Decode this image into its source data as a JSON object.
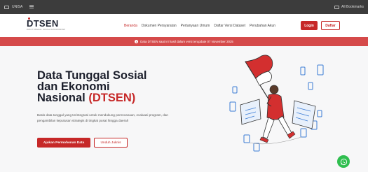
{
  "bookmarks": {
    "left_label": "UNISA",
    "right_label": "All Bookmarks"
  },
  "navbar": {
    "logo_text": "DTSEN",
    "logo_sub": "DATA TUNGGAL SOSIAL DAN EKONOMI",
    "links": [
      {
        "label": "Beranda"
      },
      {
        "label": "Dokumen Persyaratan"
      },
      {
        "label": "Pertanyaan Umum"
      },
      {
        "label": "Daftar Versi Dataset"
      },
      {
        "label": "Perubahan Akun"
      }
    ],
    "login_label": "Login",
    "register_label": "Daftar"
  },
  "announcement": {
    "text": "Data DTSEN saat ini hasil dalam versi terupdate 07 November 2025"
  },
  "hero": {
    "title_line1": "Data Tunggal Sosial",
    "title_line2": "dan Ekonomi",
    "title_line3": "Nasional",
    "title_accent": "(DTSEN)",
    "description": "Basis data tunggal yang terintegrasi untuk mendukung perencanaan, evaluasi program, dan pengambilan keputusan strategis di tingkat pusat hingga daerah",
    "primary_button": "Ajukan Permohonan Data",
    "secondary_button": "Unduh Juknis"
  },
  "colors": {
    "accent": "#c62828",
    "announcement_bg": "#d54a4a",
    "whatsapp": "#2fbe4f"
  },
  "icons": {
    "info": "info-icon",
    "whatsapp": "whatsapp-icon",
    "bookmark_folder": "folder-icon",
    "apps": "apps-grid-icon"
  }
}
